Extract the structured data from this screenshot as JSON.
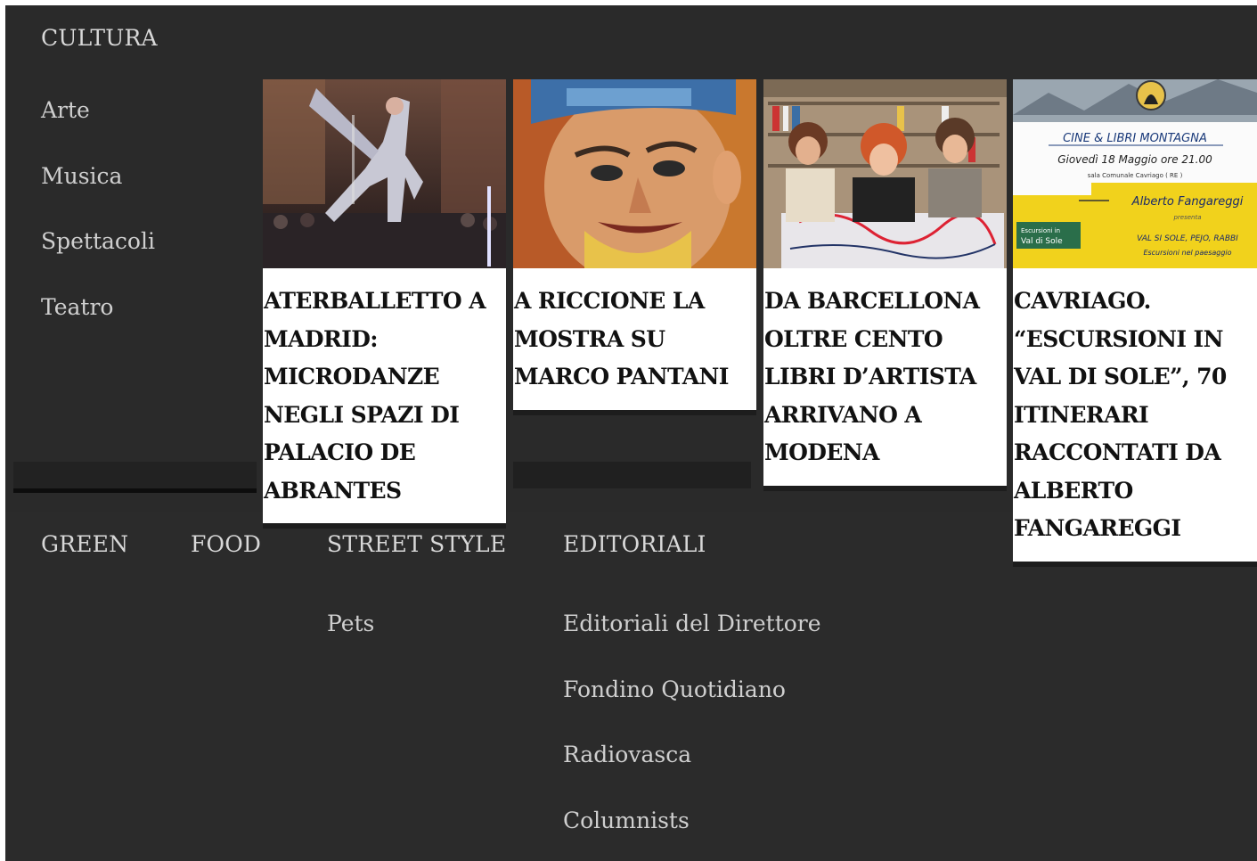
{
  "menu": {
    "cultura": {
      "title": "CULTURA",
      "items": [
        "Arte",
        "Musica",
        "Spettacoli",
        "Teatro"
      ]
    },
    "green": {
      "title": "GREEN"
    },
    "food": {
      "title": "FOOD"
    },
    "street_style": {
      "title": "STREET STYLE",
      "items": [
        "Pets"
      ]
    },
    "editoriali": {
      "title": "EDITORIALI",
      "items": [
        "Editoriali del Direttore",
        "Fondino Quotidiano",
        "Radiovasca",
        "Columnists"
      ]
    }
  },
  "articles": [
    {
      "title": "ATERBALLETTO A MADRID: MICRODANZE NEGLI SPAZI DI PALACIO DE ABRANTES",
      "image": "dancer-in-silver-costume-photo"
    },
    {
      "title": "A RICCIONE LA MOSTRA SU MARCO PANTANI",
      "image": "painted-portrait-cyclist-photo"
    },
    {
      "title": "DA BARCELLONA OLTRE CENTO LIBRI D’ARTISTA ARRIVANO A MODENA",
      "image": "three-women-with-artist-book-photo"
    },
    {
      "title": "CAVRIAGO. “ESCURSIONI IN VAL DI SOLE”, 70 ITINERARI RACCONTATI DA ALBERTO FANGAREGGI",
      "image": "event-poster-image"
    }
  ],
  "poster": {
    "line1": "CINE & LIBRI MONTAGNA",
    "line2": "Giovedì 18 Maggio ore 21.00",
    "line3": "sala Comunale Cavriago ( RE )",
    "line4": "Alberto Fangareggi",
    "line5": "presenta",
    "line6": "Escursioni in",
    "line7": "Val di Sole",
    "line8": "VAL SI SOLE, PEJO, RABBI",
    "line9": "Escursioni nel paesaggio"
  },
  "colors": {
    "menu_bg": "#2b2b2b",
    "menu_text": "#d8d8d8",
    "card_bg": "#ffffff",
    "headline_text": "#111111"
  }
}
